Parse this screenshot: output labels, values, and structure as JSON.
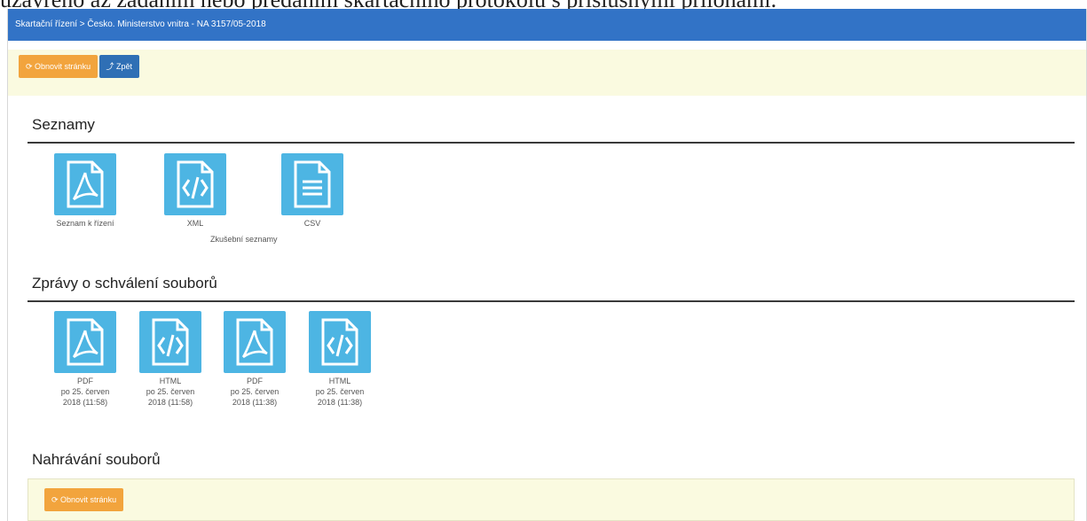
{
  "cut_text": "uzavřeno až zadáním nebo předáním skartačního protokolu s příslušnými přílohami.",
  "breadcrumb": "Skartační řízení > Česko. Ministerstvo vnitra - NA 3157/05-2018",
  "toolbar": {
    "refresh_label": "⟳ Obnovit stránku",
    "back_label": "⤴ Zpět"
  },
  "seznamy": {
    "title": "Seznamy",
    "items": [
      {
        "label": "Seznam k řízení",
        "icon": "pdf-icon"
      },
      {
        "label": "XML",
        "icon": "xml-icon"
      },
      {
        "label": "CSV",
        "icon": "csv-icon"
      }
    ],
    "caption": "Zkušební seznamy"
  },
  "zpravy": {
    "title": "Zprávy o schválení souborů",
    "items": [
      {
        "label": "PDF",
        "date": "po 25. červen 2018 (11:58)",
        "icon": "pdf-icon"
      },
      {
        "label": "HTML",
        "date": "po 25. červen 2018 (11:58)",
        "icon": "html-icon"
      },
      {
        "label": "PDF",
        "date": "po 25. červen 2018 (11:38)",
        "icon": "pdf-icon"
      },
      {
        "label": "HTML",
        "date": "po 25. červen 2018 (11:38)",
        "icon": "html-icon"
      }
    ]
  },
  "nahravani": {
    "title": "Nahrávání souborů",
    "refresh_label": "⟳ Obnovit stránku"
  },
  "colors": {
    "topbar": "#3273c6",
    "accent_orange": "#f2a43d",
    "icon_tile": "#4db5e3",
    "toolbar_bg": "#fafae0"
  }
}
